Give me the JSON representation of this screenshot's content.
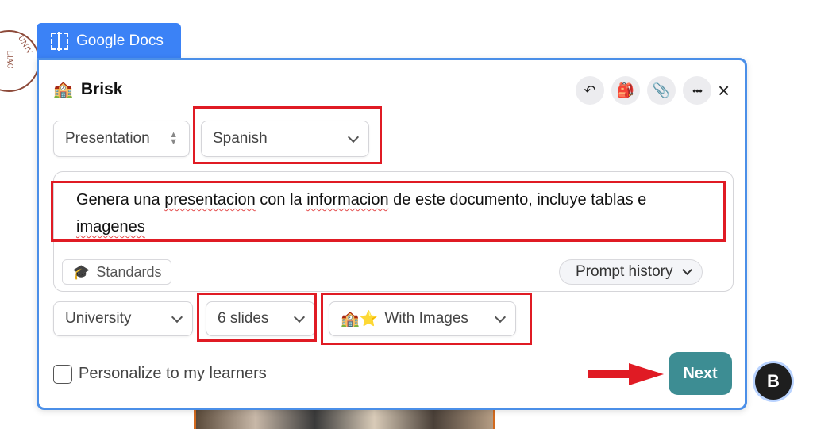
{
  "tab": {
    "label": "Google Docs"
  },
  "brand": {
    "name": "Brisk",
    "icon": "school-building-icon"
  },
  "header_buttons": [
    {
      "name": "undo-icon",
      "glyph": "↶"
    },
    {
      "name": "backpack-icon",
      "glyph": "🎒"
    },
    {
      "name": "paperclip-icon",
      "glyph": "📎"
    },
    {
      "name": "more-icon",
      "glyph": "•••"
    }
  ],
  "close": {
    "glyph": "×"
  },
  "controls": {
    "output_type": "Presentation",
    "language": "Spanish"
  },
  "prompt": {
    "segments": [
      {
        "text": "Genera una ",
        "misspelled": false
      },
      {
        "text": "presentacion",
        "misspelled": true
      },
      {
        "text": " con la ",
        "misspelled": false
      },
      {
        "text": "informacion",
        "misspelled": true
      },
      {
        "text": " de este documento, incluye tablas e ",
        "misspelled": false
      },
      {
        "text": "imagenes",
        "misspelled": true
      }
    ]
  },
  "standards": {
    "label": "Standards",
    "icon": "graduation-cap-icon"
  },
  "prompt_history": {
    "label": "Prompt history"
  },
  "options": {
    "level": "University",
    "slides": "6 slides",
    "images_label": "With Images",
    "images_emoji": "🏫⭐"
  },
  "personalize": {
    "label": "Personalize to my learners",
    "checked": false
  },
  "next": {
    "label": "Next"
  },
  "fab": {
    "glyph": "B"
  },
  "colors": {
    "tab_blue": "#3b82f6",
    "panel_border": "#4b8fe8",
    "next_teal": "#3d8d93",
    "highlight_red": "#e01b24"
  }
}
